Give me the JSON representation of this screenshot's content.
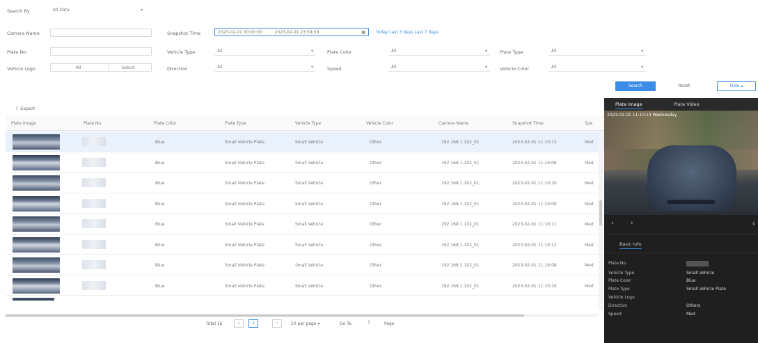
{
  "filters": {
    "search_by": {
      "label": "Search By",
      "value": "All Data"
    },
    "camera_name": {
      "label": "Camera Name",
      "value": ""
    },
    "snapshot_time": {
      "label": "Snapshot Time",
      "from": "2023-02-01 00:00:00",
      "to": "2023-02-01 23:59:59",
      "quick_links": "Today Last 3 days Last 7 days"
    },
    "plate_no": {
      "label": "Plate No.",
      "value": ""
    },
    "vehicle_type": {
      "label": "Vehicle Type",
      "value": "All"
    },
    "plate_color": {
      "label": "Plate Color",
      "value": "All"
    },
    "plate_type": {
      "label": "Plate Type",
      "value": "All"
    },
    "vehicle_logo": {
      "label": "Vehicle Logo",
      "value": "All",
      "select_label": "Select"
    },
    "direction": {
      "label": "Direction",
      "value": "All"
    },
    "speed": {
      "label": "Speed",
      "value": "All"
    },
    "vehicle_color": {
      "label": "Vehicle Color",
      "value": "All"
    },
    "search_button": "Search",
    "reset_button": "Reset",
    "more_button": "Hide"
  },
  "toolbar": {
    "export_label": "Export"
  },
  "table": {
    "columns": [
      "Plate Image",
      "Plate No.",
      "Plate Color",
      "Plate Type",
      "Vehicle Type",
      "Vehicle Color",
      "Camera Name",
      "Snapshot Time",
      "Spe"
    ],
    "rows": [
      {
        "plate_color": "Blue",
        "plate_type": "Small Vehicle Plate",
        "vehicle_type": "Small Vehicle",
        "vehicle_color": "Other",
        "camera": "192.168.1.102_01",
        "time": "2023-02-01 11:10:13",
        "speed": "Med"
      },
      {
        "plate_color": "Blue",
        "plate_type": "Small Vehicle Plate",
        "vehicle_type": "Small Vehicle",
        "vehicle_color": "Other",
        "camera": "192.168.1.102_01",
        "time": "2023-02-01 11:10:08",
        "speed": "Med"
      },
      {
        "plate_color": "Blue",
        "plate_type": "Small Vehicle Plate",
        "vehicle_type": "Small Vehicle",
        "vehicle_color": "Other",
        "camera": "192.168.1.102_01",
        "time": "2023-02-01 11:10:10",
        "speed": "Med"
      },
      {
        "plate_color": "Blue",
        "plate_type": "Small Vehicle Plate",
        "vehicle_type": "Small Vehicle",
        "vehicle_color": "Other",
        "camera": "192.168.1.102_01",
        "time": "2023-02-01 11:10:09",
        "speed": "Med"
      },
      {
        "plate_color": "Blue",
        "plate_type": "Small Vehicle Plate",
        "vehicle_type": "Small Vehicle",
        "vehicle_color": "Other",
        "camera": "192.168.1.102_01",
        "time": "2023-02-01 11:10:11",
        "speed": "Med"
      },
      {
        "plate_color": "Blue",
        "plate_type": "Small Vehicle Plate",
        "vehicle_type": "Small Vehicle",
        "vehicle_color": "Other",
        "camera": "192.168.1.102_01",
        "time": "2023-02-01 11:10:12",
        "speed": "Med"
      },
      {
        "plate_color": "Blue",
        "plate_type": "Small Vehicle Plate",
        "vehicle_type": "Small Vehicle",
        "vehicle_color": "Other",
        "camera": "192.168.1.102_01",
        "time": "2023-02-01 11:10:08",
        "speed": "Med"
      },
      {
        "plate_color": "Blue",
        "plate_type": "Small Vehicle Plate",
        "vehicle_type": "Small Vehicle",
        "vehicle_color": "Other",
        "camera": "192.168.1.102_01",
        "time": "2023-02-01 11:10:10",
        "speed": "Med"
      }
    ]
  },
  "pagination": {
    "total": "Total 16",
    "current_page": "1",
    "page_size": "10 per page",
    "goto": "Go To",
    "goto_value": "1",
    "page_suffix": "Page"
  },
  "detail_panel": {
    "tabs": [
      "Plate Image",
      "Plate Video"
    ],
    "overlay_text": "2023-02-01 11:10:13 Wednesday",
    "info_tab": "Basic Info",
    "fields": [
      {
        "key": "Plate No.",
        "value": ""
      },
      {
        "key": "Vehicle Type",
        "value": "Small Vehicle"
      },
      {
        "key": "Plate Color",
        "value": "Blue"
      },
      {
        "key": "Plate Type",
        "value": "Small Vehicle Plate"
      },
      {
        "key": "Vehicle Logo",
        "value": ""
      },
      {
        "key": "Direction",
        "value": "Others"
      },
      {
        "key": "Speed",
        "value": "Med"
      }
    ]
  },
  "colors": {
    "accent": "#3d8be8",
    "panel_bg": "#1f1f1f",
    "row_selected": "#e8f1fc"
  }
}
